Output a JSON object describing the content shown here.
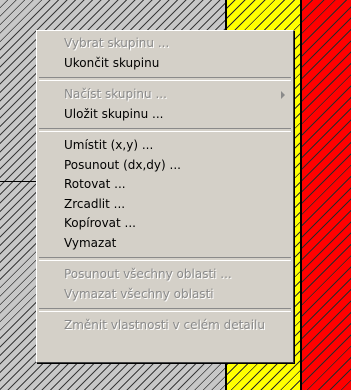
{
  "canvas": {
    "fill_colors": [
      "#c8c8c8",
      "#ffff00",
      "#ff0000"
    ]
  },
  "context_menu": {
    "items": [
      {
        "label": "Vybrat skupinu ...",
        "enabled": false
      },
      {
        "label": "Ukončit skupinu",
        "enabled": true
      },
      {
        "separator": true
      },
      {
        "label": "Načíst skupinu ...",
        "enabled": false,
        "submenu": true
      },
      {
        "label": "Uložit skupinu ...",
        "enabled": true
      },
      {
        "separator": true
      },
      {
        "label": "Umístit (x,y) ...",
        "enabled": true
      },
      {
        "label": "Posunout (dx,dy) ...",
        "enabled": true
      },
      {
        "label": "Rotovat ...",
        "enabled": true
      },
      {
        "label": "Zrcadlit ...",
        "enabled": true
      },
      {
        "label": "Kopírovat ...",
        "enabled": true
      },
      {
        "label": "Vymazat",
        "enabled": true
      },
      {
        "separator": true
      },
      {
        "label": "Posunout všechny oblasti ...",
        "enabled": false
      },
      {
        "label": "Vymazat všechny oblasti",
        "enabled": false
      },
      {
        "separator": true
      },
      {
        "label": "Změnit vlastnosti v celém detailu",
        "enabled": false
      }
    ]
  }
}
